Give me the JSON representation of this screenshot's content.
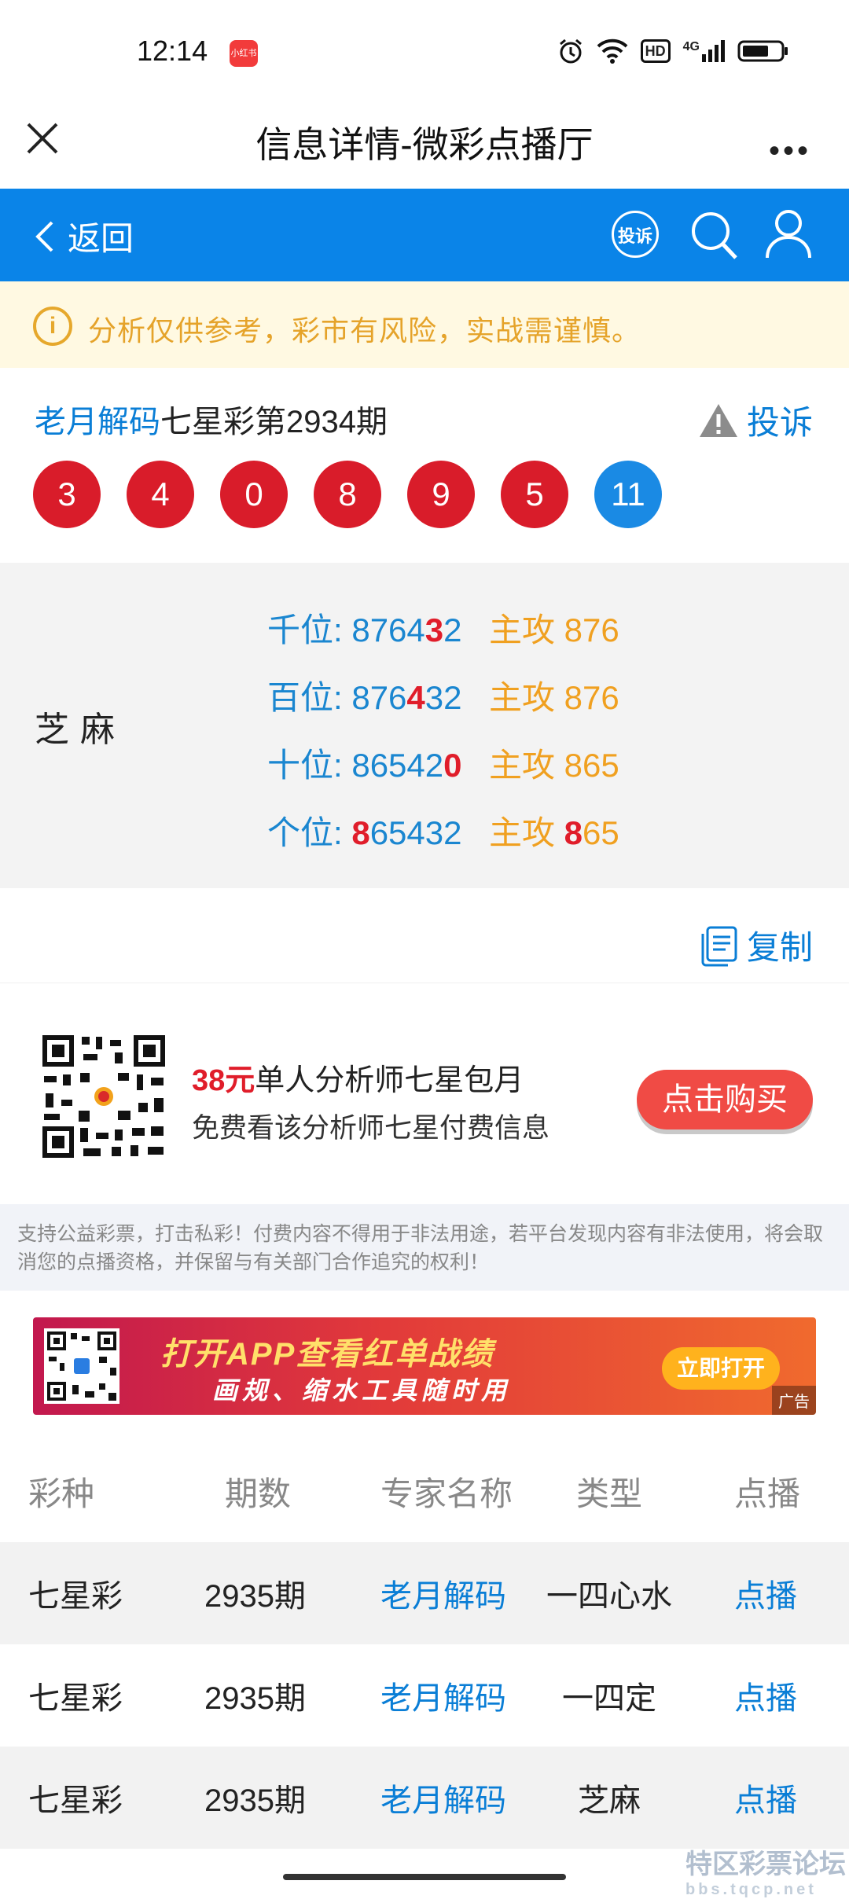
{
  "status_bar": {
    "time": "12:14",
    "app_badge": "小红书",
    "hd_label": "HD",
    "network_label": "4G"
  },
  "title_bar": {
    "title": "信息详情-微彩点播厅",
    "more_label": "•••"
  },
  "nav": {
    "back_label": "返回",
    "complain_label": "投诉"
  },
  "notice": {
    "text": "分析仅供参考，彩市有风险，实战需谨慎。"
  },
  "result": {
    "author": "老月解码",
    "lottery_period": "七星彩第2934期",
    "complain_label": "投诉",
    "numbers": [
      "3",
      "4",
      "0",
      "8",
      "9",
      "5"
    ],
    "special_number": "11"
  },
  "analysis": {
    "category": "芝麻",
    "rows": [
      {
        "label": "千位: ",
        "pre": "8764",
        "hit": "3",
        "post": "2",
        "main_label": "主攻 ",
        "main_hit": "",
        "main_rest": "876"
      },
      {
        "label": "百位: ",
        "pre": "876",
        "hit": "4",
        "post": "32",
        "main_label": "主攻 ",
        "main_hit": "",
        "main_rest": "876"
      },
      {
        "label": "十位: ",
        "pre": "86542",
        "hit": "0",
        "post": "",
        "main_label": "主攻 ",
        "main_hit": "",
        "main_rest": "865"
      },
      {
        "label": "个位: ",
        "pre": "",
        "hit": "8",
        "post": "65432",
        "main_label": "主攻 ",
        "main_hit": "8",
        "main_rest": "65"
      }
    ]
  },
  "copy": {
    "label": "复制"
  },
  "promo": {
    "price": "38元",
    "title": "单人分析师七星包月",
    "subtitle": "免费看该分析师七星付费信息",
    "buy_label": "点击购买"
  },
  "disclaimer": {
    "text": "支持公益彩票，打击私彩！付费内容不得用于非法用途，若平台发现内容有非法使用，将会取消您的点播资格，并保留与有关部门合作追究的权利！"
  },
  "banner": {
    "line1": "打开APP查看红单战绩",
    "line2": "画规、缩水工具随时用",
    "open_label": "立即打开",
    "ad_label": "广告"
  },
  "table": {
    "headers": [
      "彩种",
      "期数",
      "专家名称",
      "类型",
      "点播"
    ],
    "rows": [
      {
        "lottery": "七星彩",
        "period": "2935期",
        "expert": "老月解码",
        "type": "一四心水",
        "action": "点播"
      },
      {
        "lottery": "七星彩",
        "period": "2935期",
        "expert": "老月解码",
        "type": "一四定",
        "action": "点播"
      },
      {
        "lottery": "七星彩",
        "period": "2935期",
        "expert": "老月解码",
        "type": "芝麻",
        "action": "点播"
      }
    ]
  },
  "watermark": {
    "title": "特区彩票论坛",
    "subtitle": "bbs.tqcp.net"
  },
  "colors": {
    "nav_blue": "#0a84e8",
    "ball_red": "#d91c2a",
    "ball_blue": "#1a8ae4",
    "link_blue": "#0a7ed6",
    "accent_orange": "#f0a020",
    "hit_red": "#e01d2a"
  }
}
